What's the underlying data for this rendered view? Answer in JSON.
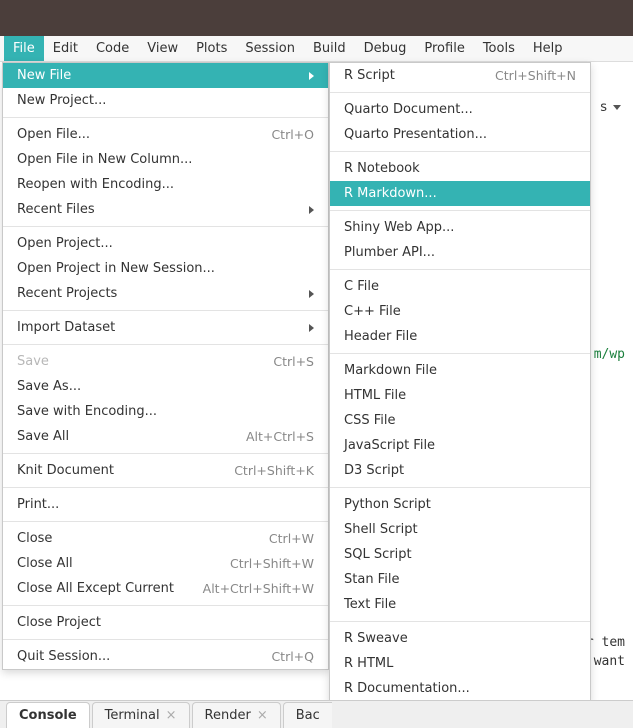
{
  "menubar": {
    "items": [
      "File",
      "Edit",
      "Code",
      "View",
      "Plots",
      "Session",
      "Build",
      "Debug",
      "Profile",
      "Tools",
      "Help"
    ]
  },
  "bgDropdownLabel": "s",
  "fileMenu": {
    "rows": [
      {
        "label": "New File",
        "submenu": true,
        "highlight": true
      },
      {
        "label": "New Project..."
      },
      {
        "sep": true
      },
      {
        "label": "Open File...",
        "shortcut": "Ctrl+O"
      },
      {
        "label": "Open File in New Column..."
      },
      {
        "label": "Reopen with Encoding..."
      },
      {
        "label": "Recent Files",
        "submenu": true
      },
      {
        "sep": true
      },
      {
        "label": "Open Project..."
      },
      {
        "label": "Open Project in New Session..."
      },
      {
        "label": "Recent Projects",
        "submenu": true
      },
      {
        "sep": true
      },
      {
        "label": "Import Dataset",
        "submenu": true
      },
      {
        "sep": true
      },
      {
        "label": "Save",
        "shortcut": "Ctrl+S",
        "disabled": true
      },
      {
        "label": "Save As..."
      },
      {
        "label": "Save with Encoding..."
      },
      {
        "label": "Save All",
        "shortcut": "Alt+Ctrl+S"
      },
      {
        "sep": true
      },
      {
        "label": "Knit Document",
        "shortcut": "Ctrl+Shift+K"
      },
      {
        "sep": true
      },
      {
        "label": "Print..."
      },
      {
        "sep": true
      },
      {
        "label": "Close",
        "shortcut": "Ctrl+W"
      },
      {
        "label": "Close All",
        "shortcut": "Ctrl+Shift+W"
      },
      {
        "label": "Close All Except Current",
        "shortcut": "Alt+Ctrl+Shift+W"
      },
      {
        "sep": true
      },
      {
        "label": "Close Project"
      },
      {
        "sep": true
      },
      {
        "label": "Quit Session...",
        "shortcut": "Ctrl+Q"
      }
    ]
  },
  "newFileMenu": {
    "rows": [
      {
        "label": "R Script",
        "shortcut": "Ctrl+Shift+N"
      },
      {
        "sep": true
      },
      {
        "label": "Quarto Document..."
      },
      {
        "label": "Quarto Presentation..."
      },
      {
        "sep": true
      },
      {
        "label": "R Notebook"
      },
      {
        "label": "R Markdown...",
        "highlight": true
      },
      {
        "sep": true
      },
      {
        "label": "Shiny Web App..."
      },
      {
        "label": "Plumber API..."
      },
      {
        "sep": true
      },
      {
        "label": "C File"
      },
      {
        "label": "C++ File"
      },
      {
        "label": "Header File"
      },
      {
        "sep": true
      },
      {
        "label": "Markdown File"
      },
      {
        "label": "HTML File"
      },
      {
        "label": "CSS File"
      },
      {
        "label": "JavaScript File"
      },
      {
        "label": "D3 Script"
      },
      {
        "sep": true
      },
      {
        "label": "Python Script"
      },
      {
        "label": "Shell Script"
      },
      {
        "label": "SQL Script"
      },
      {
        "label": "Stan File"
      },
      {
        "label": "Text File"
      },
      {
        "sep": true
      },
      {
        "label": "R Sweave"
      },
      {
        "label": "R HTML"
      },
      {
        "label": "R Documentation..."
      }
    ]
  },
  "tabs": [
    {
      "label": "Console",
      "closable": false,
      "active": true
    },
    {
      "label": "Terminal",
      "closable": true
    },
    {
      "label": "Render",
      "closable": true
    },
    {
      "label": "Bac",
      "closable": false,
      "partial": true
    }
  ],
  "background": {
    "linkFrag": "m/wp",
    "textFrag": "r tem\nwant"
  }
}
